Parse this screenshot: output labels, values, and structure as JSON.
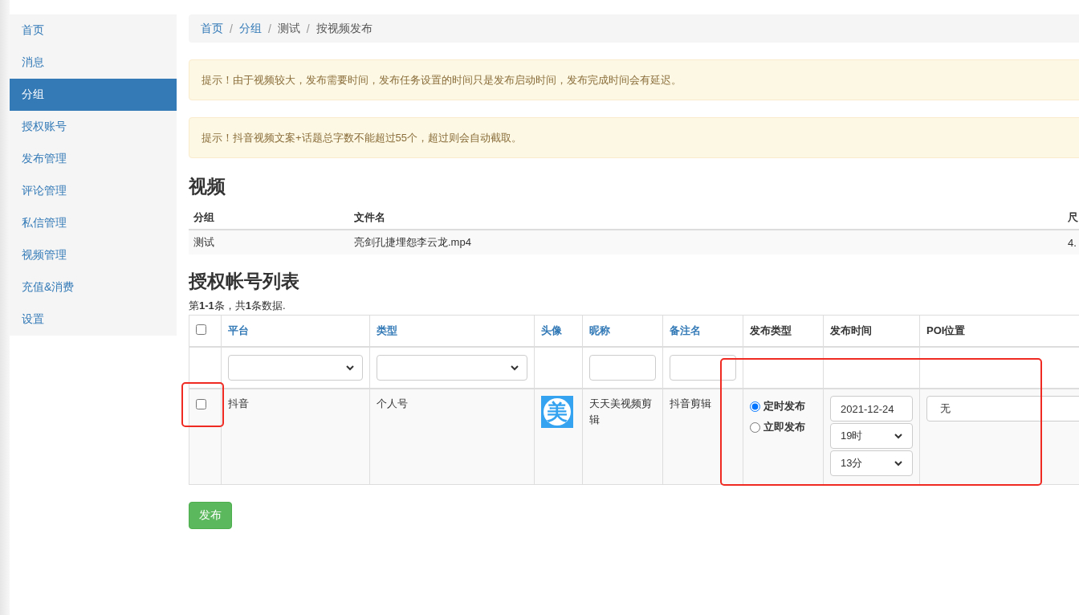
{
  "sidebar": {
    "items": [
      {
        "label": "首页",
        "selected": false
      },
      {
        "label": "消息",
        "selected": false
      },
      {
        "label": "分组",
        "selected": true
      },
      {
        "label": "授权账号",
        "selected": false
      },
      {
        "label": "发布管理",
        "selected": false
      },
      {
        "label": "评论管理",
        "selected": false
      },
      {
        "label": "私信管理",
        "selected": false
      },
      {
        "label": "视频管理",
        "selected": false
      },
      {
        "label": "充值&消费",
        "selected": false
      },
      {
        "label": "设置",
        "selected": false
      }
    ]
  },
  "breadcrumb": [
    {
      "label": "首页",
      "kind": "link"
    },
    {
      "label": "分组",
      "kind": "link",
      "separator_before": "/"
    },
    {
      "label": "测试",
      "kind": "text",
      "separator_before": "/"
    },
    {
      "label": "按视频发布",
      "kind": "text",
      "separator_before": "/"
    }
  ],
  "alerts": [
    "提示！由于视频较大，发布需要时间，发布任务设置的时间只是发布启动时间，发布完成时间会有延迟。",
    "提示！抖音视频文案+话题总字数不能超过55个，超过则会自动截取。"
  ],
  "video": {
    "title": "视频",
    "columns": [
      "分组",
      "文件名",
      "尺"
    ],
    "rows": [
      [
        "测试",
        "亮剑孔捷埋怨李云龙.mp4",
        "4."
      ]
    ]
  },
  "accounts": {
    "title": "授权帐号列表",
    "summary": "第**1-1**条，共**1**条数据.",
    "select_all": {
      "checked": false
    },
    "columns": [
      {
        "label": "平台",
        "kind": "link"
      },
      {
        "label": "类型",
        "kind": "link"
      },
      {
        "label": "头像",
        "kind": "link"
      },
      {
        "label": "昵称",
        "kind": "link"
      },
      {
        "label": "备注名",
        "kind": "link"
      },
      {
        "label": "发布类型",
        "kind": "text"
      },
      {
        "label": "发布时间",
        "kind": "text"
      },
      {
        "label": "POI位置",
        "kind": "text"
      }
    ],
    "filters": [
      {
        "kind": "select"
      },
      {
        "kind": "select"
      },
      {
        "kind": "empty"
      },
      {
        "kind": "input"
      },
      {
        "kind": "input"
      },
      {
        "kind": "empty"
      },
      {
        "kind": "empty"
      },
      {
        "kind": "empty"
      }
    ],
    "rows": [
      {
        "checked": false,
        "platform": "抖音",
        "type": "个人号",
        "avatar_text": "美",
        "nickname": "天天美视频剪辑",
        "remark": "抖音剪辑",
        "publish_types": [
          {
            "label": "定时发布",
            "selected": true
          },
          {
            "label": "立即发布",
            "selected": false
          }
        ],
        "date": "2021-12-24",
        "hour": "19时",
        "minute": "13分",
        "poi": "无"
      }
    ]
  },
  "publish_button": "发布"
}
